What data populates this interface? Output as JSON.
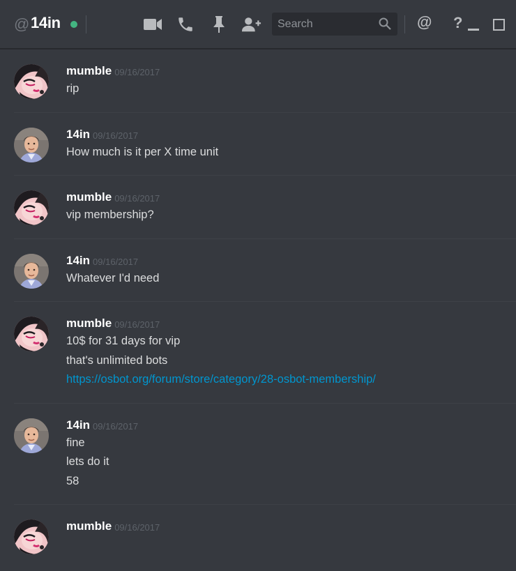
{
  "header": {
    "at_symbol": "@",
    "channel_name": "14in",
    "status_color": "#43b581",
    "icons": [
      "video-call-icon",
      "voice-call-icon",
      "pin-icon",
      "add-friend-icon"
    ],
    "search": {
      "placeholder": "Search",
      "value": ""
    },
    "mention_label": "@",
    "help_label": "?"
  },
  "messages": [
    {
      "author": "mumble",
      "timestamp": "09/16/2017",
      "avatar": "mumble-avatar",
      "lines": [
        "rip"
      ]
    },
    {
      "author": "14in",
      "timestamp": "09/16/2017",
      "avatar": "14in-avatar",
      "lines": [
        "How much is it per X time unit"
      ]
    },
    {
      "author": "mumble",
      "timestamp": "09/16/2017",
      "avatar": "mumble-avatar",
      "lines": [
        "vip membership?"
      ]
    },
    {
      "author": "14in",
      "timestamp": "09/16/2017",
      "avatar": "14in-avatar",
      "lines": [
        "Whatever I'd need"
      ]
    },
    {
      "author": "mumble",
      "timestamp": "09/16/2017",
      "avatar": "mumble-avatar",
      "lines": [
        "10$ for 31 days for vip",
        "that's unlimited bots"
      ],
      "link": "https://osbot.org/forum/store/category/28-osbot-membership/"
    },
    {
      "author": "14in",
      "timestamp": "09/16/2017",
      "avatar": "14in-avatar",
      "lines": [
        "fine",
        "lets do it",
        "58"
      ]
    },
    {
      "author": "mumble",
      "timestamp": "09/16/2017",
      "avatar": "mumble-avatar",
      "lines": []
    }
  ],
  "colors": {
    "background": "#36393f",
    "text": "#dcddde",
    "author": "#ffffff",
    "timestamp": "#5d6269",
    "link": "#0096cf"
  }
}
